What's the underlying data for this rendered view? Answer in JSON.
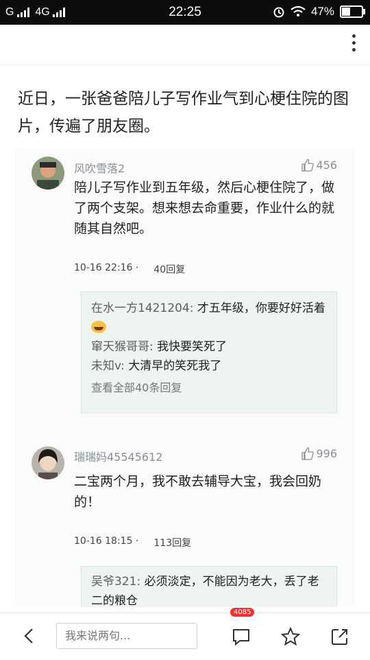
{
  "status_bar": {
    "signal_left": "G",
    "network": "4G",
    "time": "22:25",
    "battery_percent": "47%",
    "battery_level": 0.47
  },
  "article": {
    "headline": "近日，一张爸爸陪儿子写作业气到心梗住院的图片，传遍了朋友圈。"
  },
  "comments": [
    {
      "user": "风吹雪落2",
      "likes": "456",
      "text": "陪儿子写作业到五年级，然后心梗住院了，做了两个支架。想来想去命重要，作业什么的就随其自然吧。",
      "date": "10-16 22:16 ·",
      "reply_count": "40回复",
      "replies": [
        {
          "name": "在水一方1421204:",
          "text": " 才五年级，你要好好活着"
        },
        {
          "name": "窜天猴哥哥:",
          "text": " 我快要笑死了"
        },
        {
          "name": "未知v:",
          "text": " 大清早的笑死我了"
        }
      ],
      "view_all": "查看全部40条回复"
    },
    {
      "user": "瑞瑞妈45545612",
      "likes": "996",
      "text": "二宝两个月，我不敢去辅导大宝，我会回奶的！",
      "date": "10-16 18:15 ·",
      "reply_count": "113回复",
      "replies": [
        {
          "name": "吴爷321:",
          "text": " 必须淡定，不能因为老大，丢了老二的粮仓"
        }
      ]
    }
  ],
  "bottom_bar": {
    "comment_placeholder": "我来说两句...",
    "comment_badge": "4085"
  },
  "colors": {
    "status_bg": "#0d0d0d",
    "reply_bg": "#eef4ef",
    "muted": "#8a8f97"
  }
}
